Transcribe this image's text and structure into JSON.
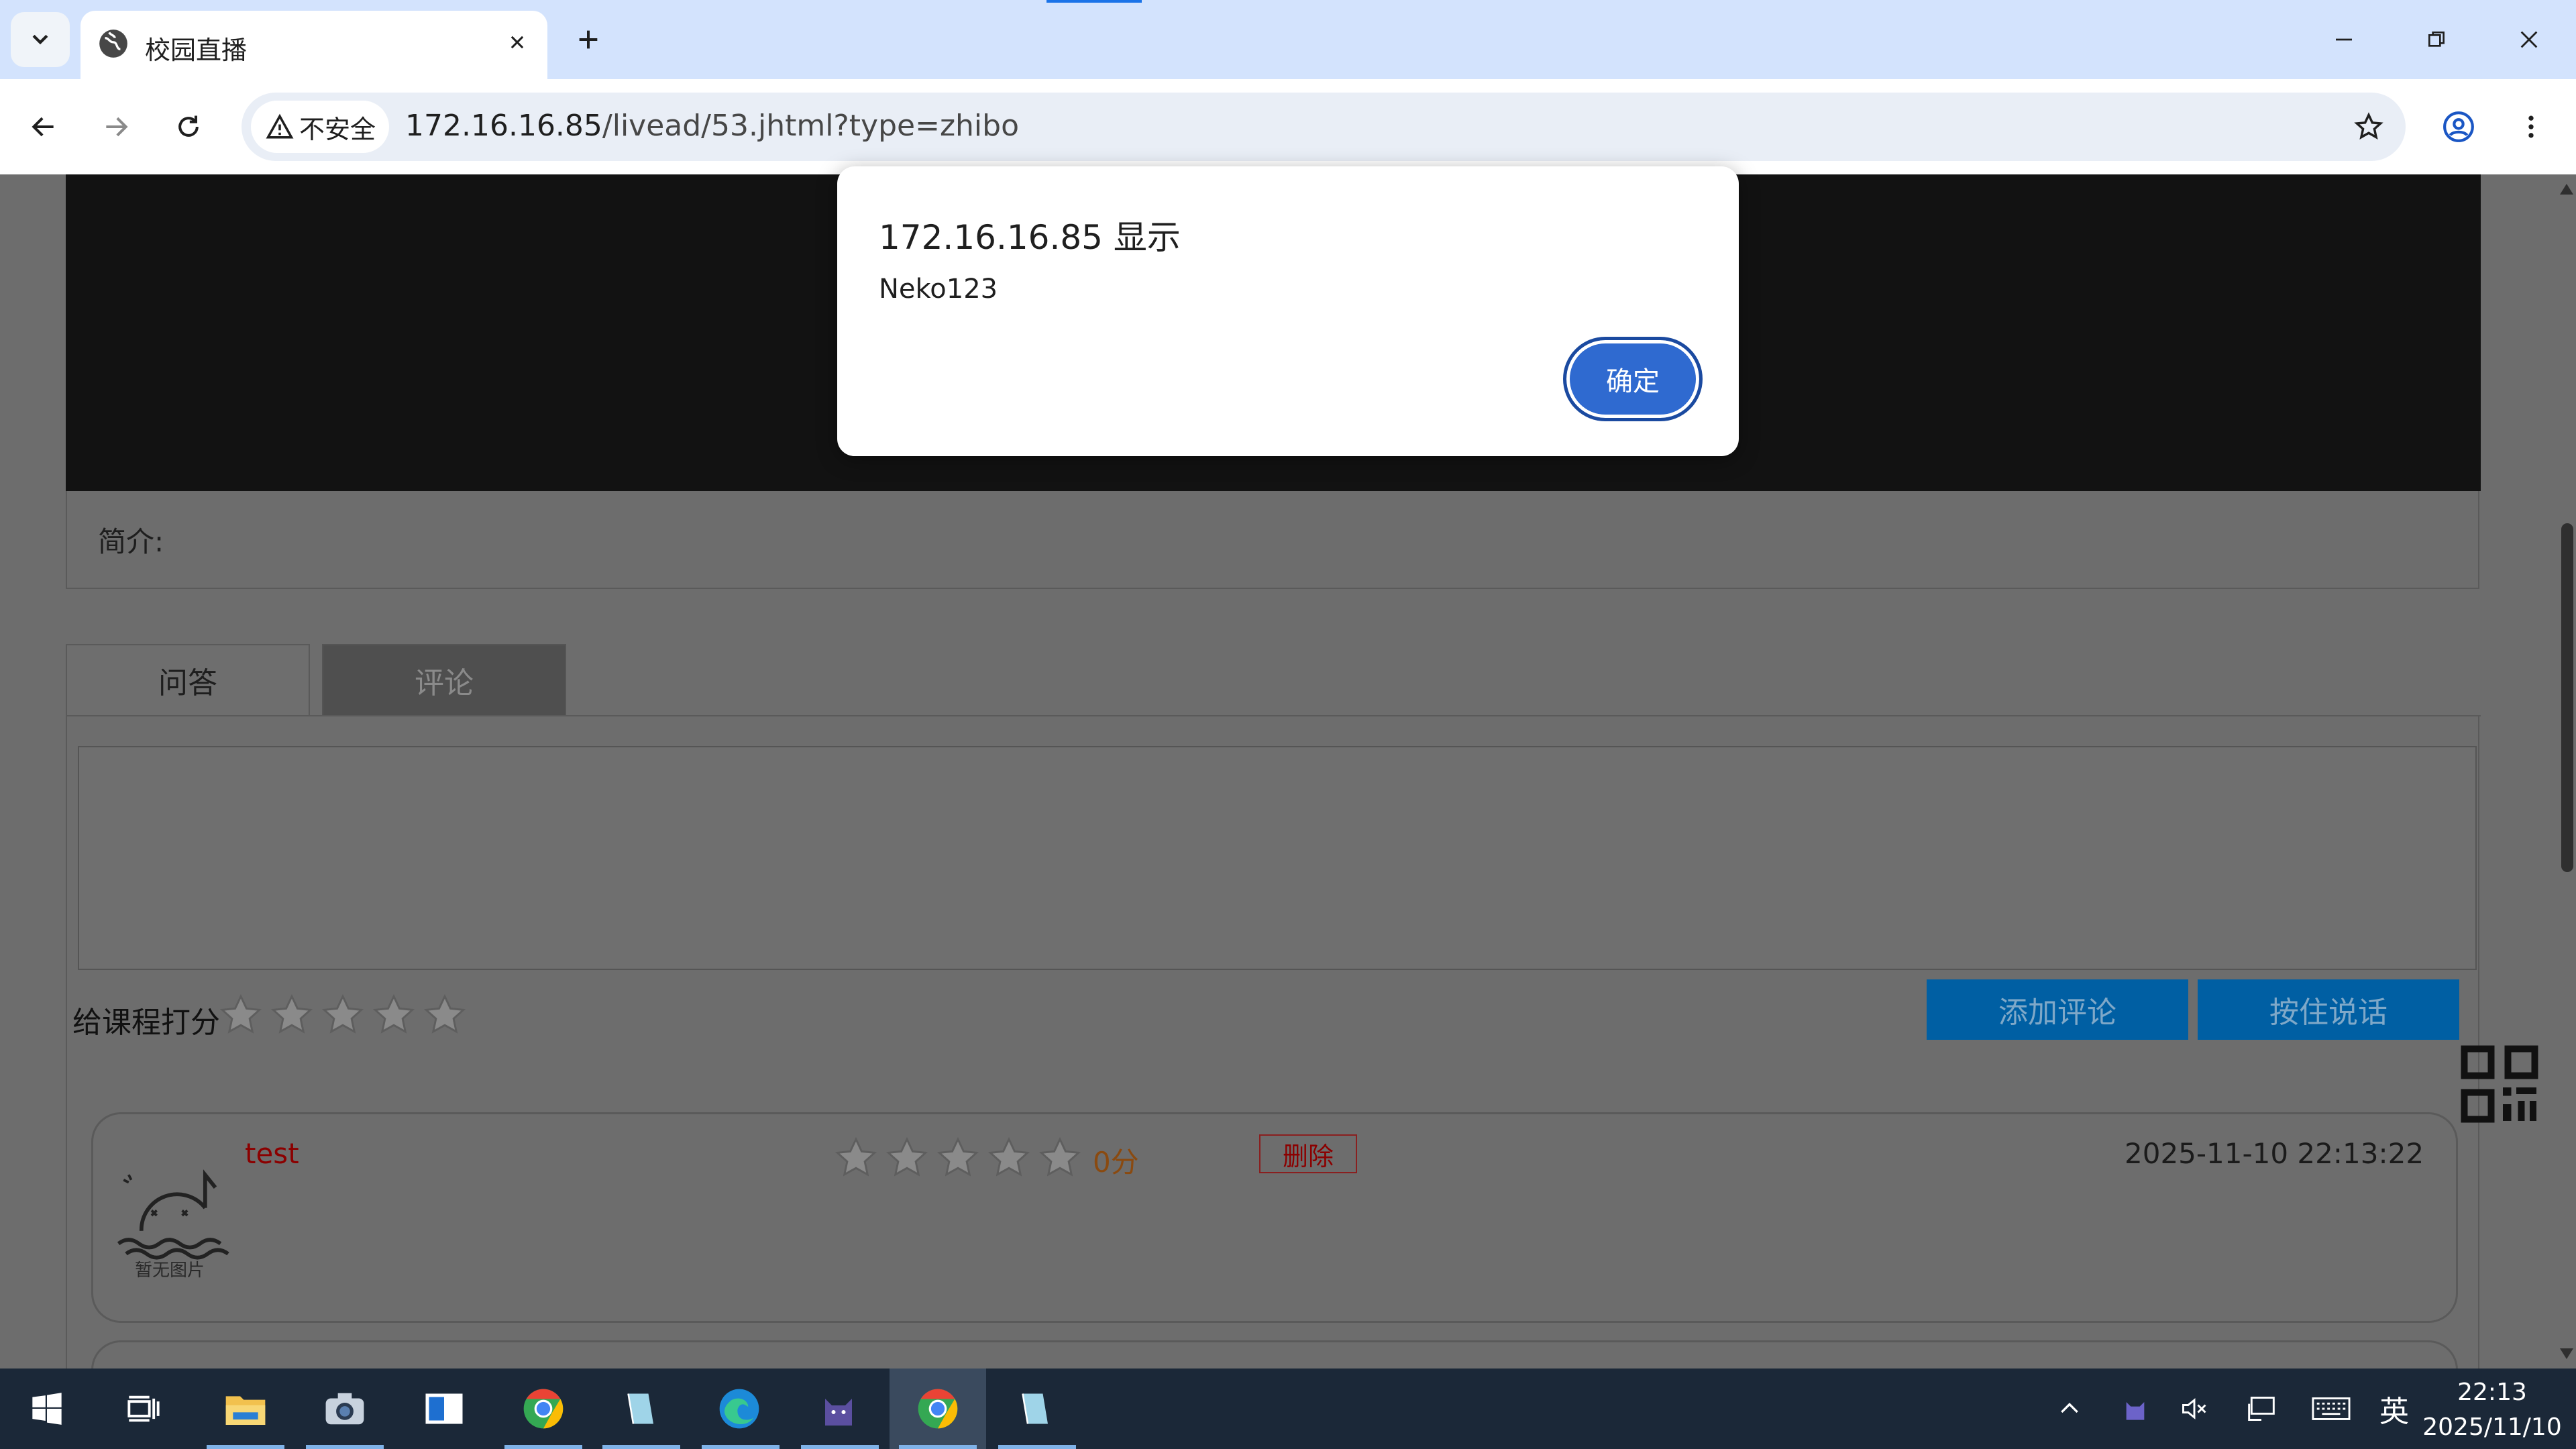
{
  "browser": {
    "tab_title": "校园直播",
    "security_label": "不安全",
    "url_host": "172.16.16.85",
    "url_path": "/livead/53.jhtml?type=zhibo"
  },
  "page": {
    "intro_label": "简介:",
    "tabs": [
      {
        "label": "问答"
      },
      {
        "label": "评论"
      }
    ],
    "rate_label": "给课程打分",
    "add_comment_label": "添加评论",
    "hold_to_talk_label": "按住说话",
    "comments": [
      {
        "user": "test",
        "no_image": "暂无图片",
        "score": "0分",
        "delete_label": "删除",
        "time": "2025-11-10 22:13:22"
      }
    ]
  },
  "dialog": {
    "title": "172.16.16.85 显示",
    "message": "Neko123",
    "ok_label": "确定"
  },
  "taskbar": {
    "ime_label": "英",
    "time": "22:13",
    "date": "2025/11/10"
  },
  "colors": {
    "dim_overlay": "#6d6d6d",
    "accent_blue": "#2f6ad0",
    "button_blue": "#005fa3",
    "tab_strip": "#d3e3fd"
  }
}
